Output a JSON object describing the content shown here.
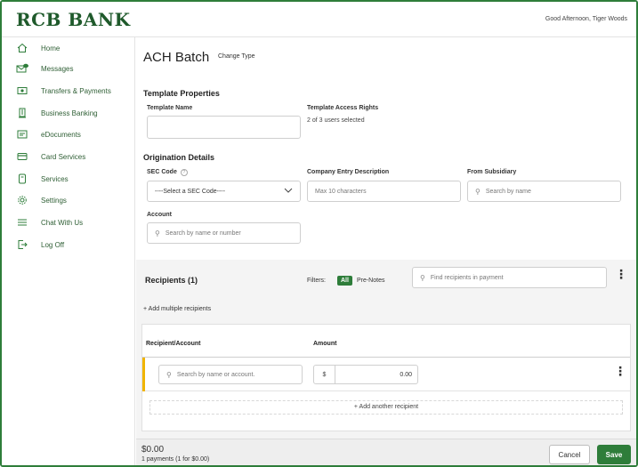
{
  "brand": {
    "name": "RCB BANK",
    "color": "#1f5a2b",
    "accent": "#2e7d3a",
    "warning": "#f0b400"
  },
  "header": {
    "greeting": "Good Afternoon, Tiger Woods"
  },
  "sidebar": {
    "items": [
      {
        "label": "Home",
        "icon": "home-icon"
      },
      {
        "label": "Messages",
        "icon": "envelope-icon"
      },
      {
        "label": "Transfers & Payments",
        "icon": "transfer-icon"
      },
      {
        "label": "Business Banking",
        "icon": "building-icon"
      },
      {
        "label": "eDocuments",
        "icon": "document-icon"
      },
      {
        "label": "Card Services",
        "icon": "card-icon"
      },
      {
        "label": "Services",
        "icon": "services-icon"
      },
      {
        "label": "Settings",
        "icon": "gear-icon"
      },
      {
        "label": "Chat With Us",
        "icon": "chat-icon"
      },
      {
        "label": "Log Off",
        "icon": "logout-icon"
      }
    ]
  },
  "page": {
    "title": "ACH Batch",
    "change_type": "Change Type"
  },
  "template_properties": {
    "heading": "Template Properties",
    "template_name_label": "Template Name",
    "template_name_value": "",
    "access_rights_label": "Template Access Rights",
    "access_rights_value": "2 of 3 users selected"
  },
  "origination": {
    "heading": "Origination Details",
    "sec_code_label": "SEC Code",
    "sec_code_help": "?",
    "sec_code_selected": "----Select a SEC Code----",
    "company_entry_label": "Company Entry Description",
    "company_entry_placeholder": "Max 10 characters",
    "from_subsidiary_label": "From Subsidiary",
    "from_subsidiary_placeholder": "Search by name",
    "account_label": "Account",
    "account_placeholder": "Search by name or number"
  },
  "recipients": {
    "title": "Recipients (1)",
    "filters_label": "Filters:",
    "filter_all": "All",
    "filter_prenotes": "Pre-Notes",
    "find_placeholder": "Find recipients in payment",
    "add_multiple": "+ Add multiple recipients",
    "columns": {
      "recipient": "Recipient/Account",
      "amount": "Amount"
    },
    "row": {
      "search_placeholder": "Search by name or account.",
      "currency": "$",
      "amount": "0.00"
    },
    "add_another": "+ Add another recipient"
  },
  "footer": {
    "total": "$0.00",
    "summary": "1 payments (1 for $0.00)",
    "cancel": "Cancel",
    "save": "Save"
  }
}
